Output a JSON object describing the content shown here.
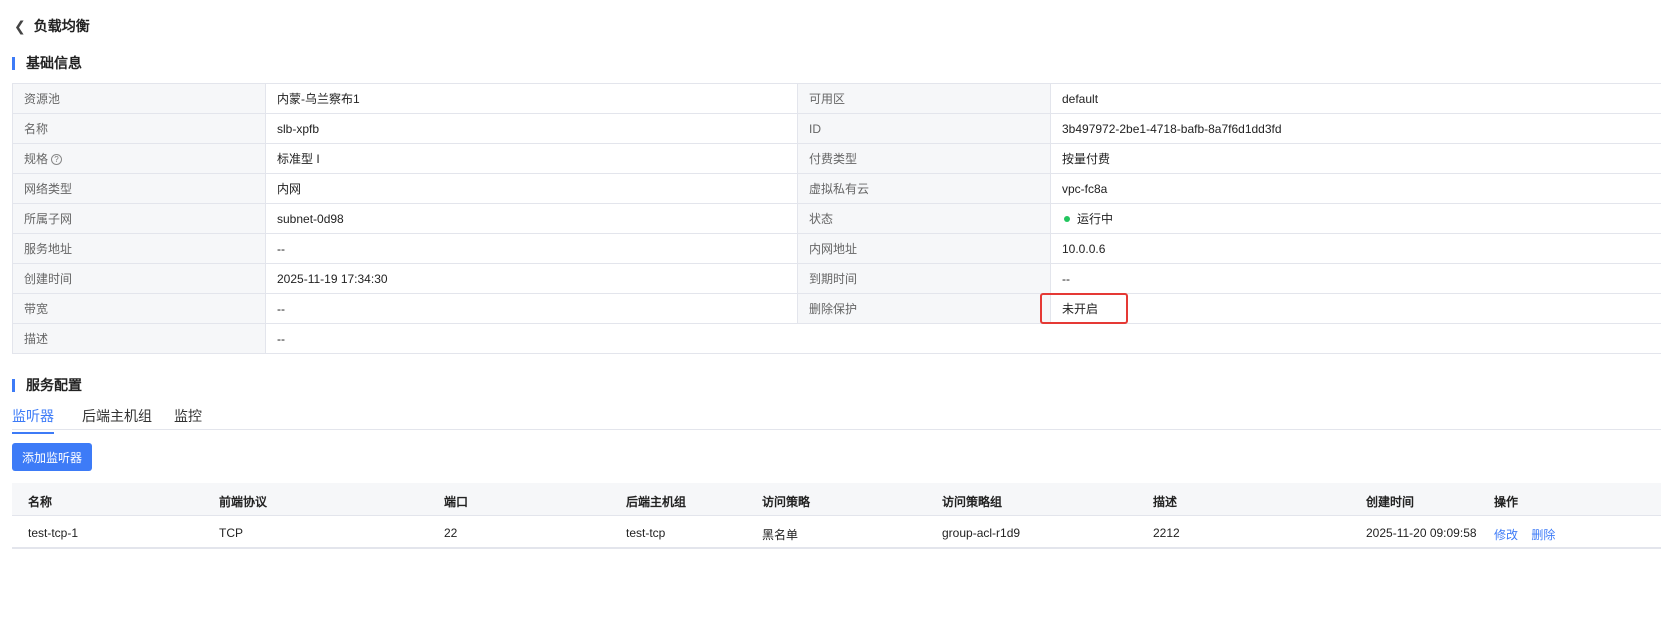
{
  "header": {
    "back_icon": "chevron-left-icon",
    "title": "负载均衡"
  },
  "basic": {
    "title": "基础信息",
    "rows": [
      [
        "资源池",
        "内蒙-乌兰察布1",
        "可用区",
        "default"
      ],
      [
        "名称",
        "slb-xpfb",
        "ID",
        "3b497972-2be1-4718-bafb-8a7f6d1dd3fd"
      ],
      [
        "规格",
        "标准型 I",
        "付费类型",
        "按量付费"
      ],
      [
        "网络类型",
        "内网",
        "虚拟私有云",
        "vpc-fc8a"
      ],
      [
        "所属子网",
        "subnet-0d98",
        "状态",
        "运行中"
      ],
      [
        "服务地址",
        "--",
        "内网地址",
        "10.0.0.6"
      ],
      [
        "创建时间",
        "2025-11-19 17:34:30",
        "到期时间",
        "--"
      ],
      [
        "带宽",
        "--",
        "删除保护",
        "未开启"
      ]
    ],
    "desc_label": "描述",
    "desc_value": "--",
    "status_color": "#22c55e"
  },
  "service": {
    "title": "服务配置",
    "tabs": [
      "监听器",
      "后端主机组",
      "监控"
    ],
    "add_button": "添加监听器",
    "columns": [
      "名称",
      "前端协议",
      "端口",
      "后端主机组",
      "访问策略",
      "访问策略组",
      "描述",
      "创建时间",
      "操作"
    ],
    "rows": [
      {
        "name": "test-tcp-1",
        "protocol": "TCP",
        "port": "22",
        "backend": "test-tcp",
        "policy": "黑名单",
        "policy_group": "group-acl-r1d9",
        "desc": "2212",
        "created": "2025-11-20 09:09:58",
        "actions": [
          "修改",
          "删除"
        ]
      }
    ]
  },
  "accent": "#3d7bf7"
}
